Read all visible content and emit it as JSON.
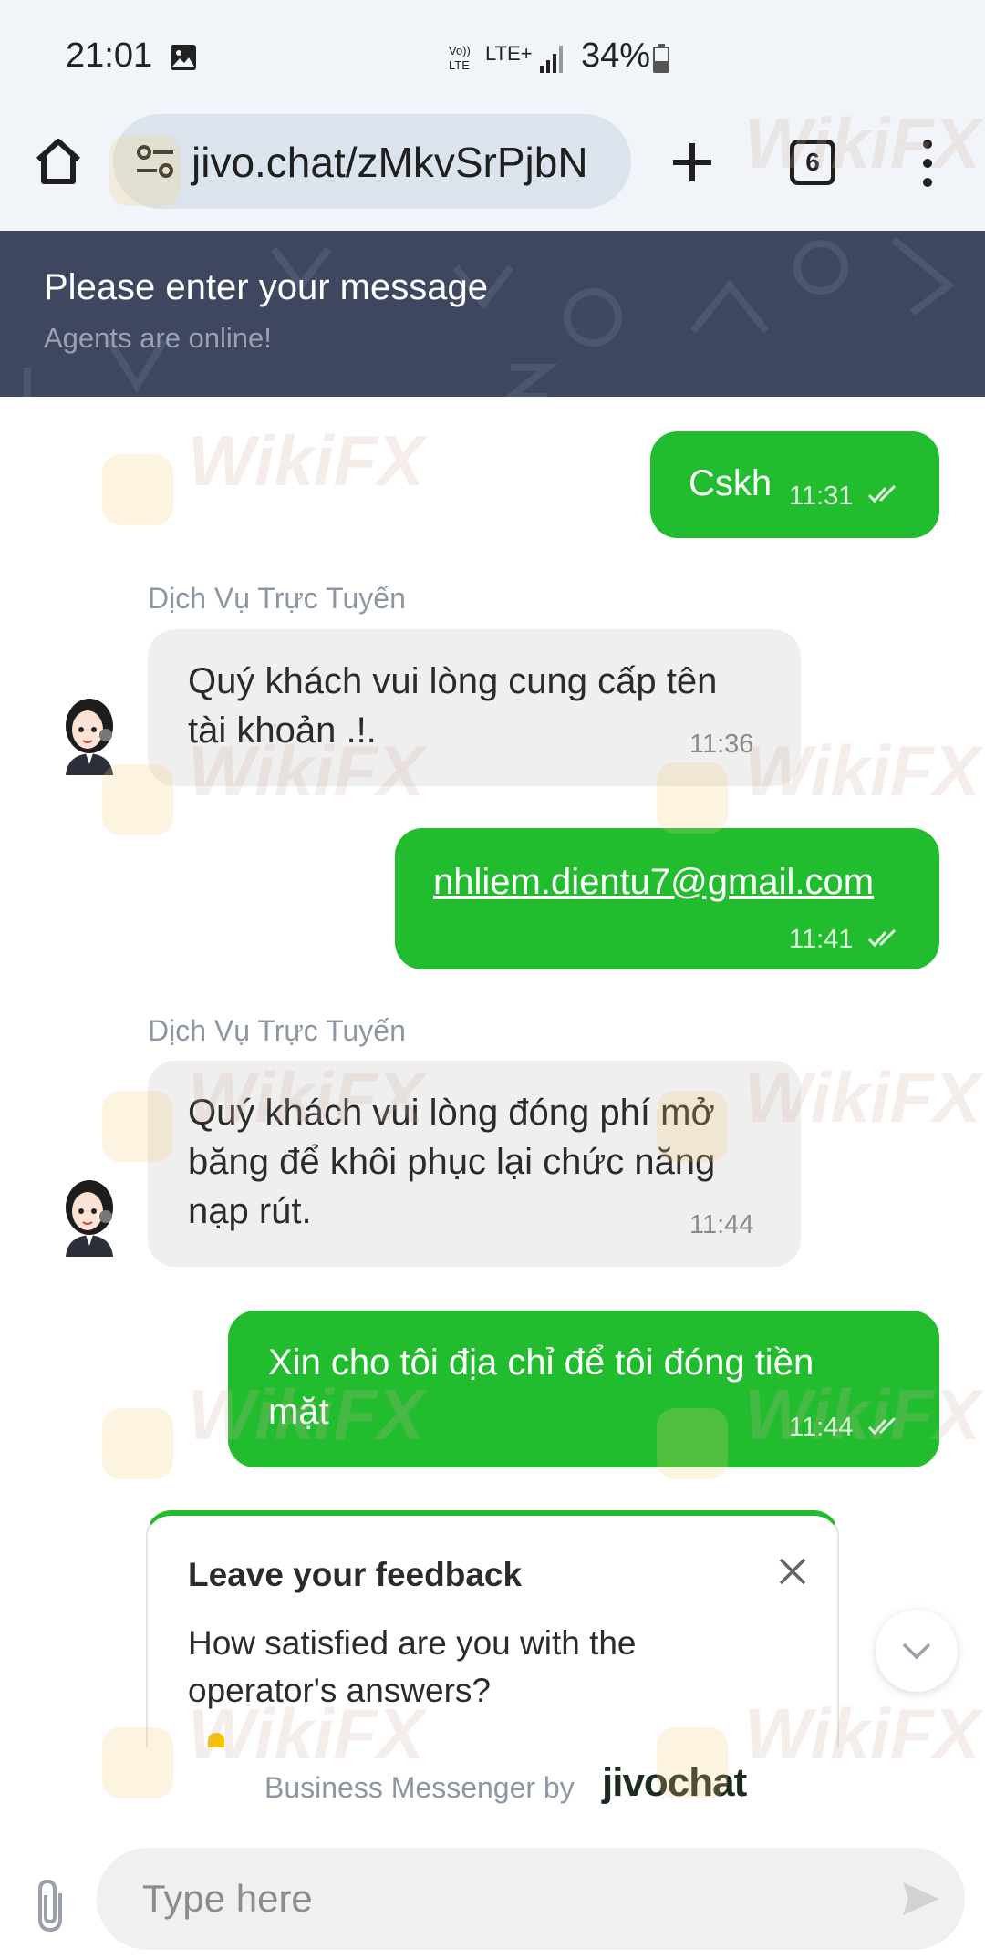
{
  "status_bar": {
    "time": "21:01",
    "network": "LTE+",
    "battery": "34%",
    "icons": [
      "gallery-icon",
      "volte-icon",
      "signal-icon",
      "battery-icon"
    ]
  },
  "browser": {
    "url": "jivo.chat/zMkvSrPjbN",
    "tab_count": "6",
    "icons": [
      "home-icon",
      "site-settings-icon",
      "plus-icon",
      "tabs-icon",
      "more-vert-icon"
    ]
  },
  "header": {
    "title": "Please enter your message",
    "subtitle": "Agents are online!"
  },
  "messages": [
    {
      "direction": "out",
      "text": "Cskh",
      "time": "11:31"
    },
    {
      "direction": "in",
      "sender": "Dịch Vụ Trực Tuyến",
      "line1": "Quý khách vui lòng cung cấp tên",
      "line2": "tài khoản .!.",
      "time": "11:36"
    },
    {
      "direction": "out",
      "text": "nhliem.dientu7@gmail.com",
      "time": "11:41"
    },
    {
      "direction": "in",
      "sender": "Dịch Vụ Trực Tuyến",
      "line1": "Quý khách vui lòng đóng phí mở",
      "line2": "băng để khôi phục lại chức năng",
      "line3": "nạp rút.",
      "time": "11:44"
    },
    {
      "direction": "out",
      "line1": "Xin cho tôi địa chỉ để tôi đóng tiền",
      "line2": "mặt",
      "time": "11:44"
    }
  ],
  "feedback": {
    "title": "Leave your feedback",
    "question": "How satisfied are you with the operator's answers?"
  },
  "powered_by": {
    "text": "Business Messenger by",
    "brand": "jivochat"
  },
  "composer": {
    "placeholder": "Type here"
  },
  "watermark": "WikiFX",
  "colors": {
    "outgoing_bubble": "#21bd2f",
    "incoming_bubble": "#efefef",
    "header_bg": "#3e4660",
    "browser_bg": "#f1f5f9"
  }
}
